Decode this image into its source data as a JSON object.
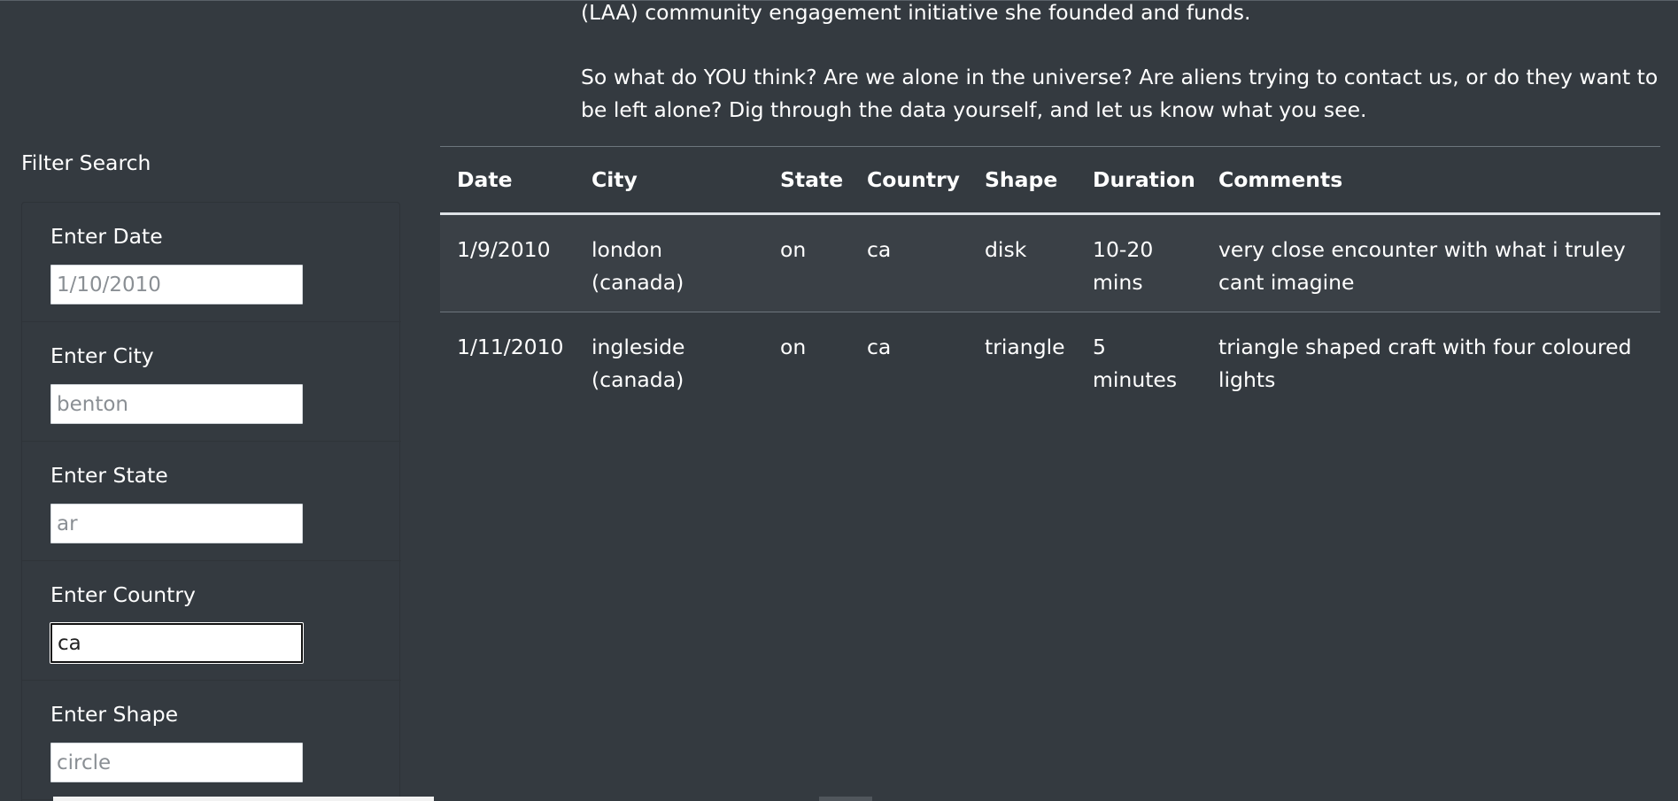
{
  "intro": {
    "line_top": "(LAA) community engagement initiative she founded and funds.",
    "paragraph": "So what do YOU think? Are we alone in the universe? Are aliens trying to contact us, or do they want to be left alone? Dig through the data yourself, and let us know what you see."
  },
  "filter": {
    "title": "Filter Search",
    "items": [
      {
        "label": "Enter Date",
        "placeholder": "1/10/2010",
        "value": ""
      },
      {
        "label": "Enter City",
        "placeholder": "benton",
        "value": ""
      },
      {
        "label": "Enter State",
        "placeholder": "ar",
        "value": ""
      },
      {
        "label": "Enter Country",
        "placeholder": "",
        "value": "ca"
      },
      {
        "label": "Enter Shape",
        "placeholder": "circle",
        "value": ""
      }
    ]
  },
  "table": {
    "headers": [
      "Date",
      "City",
      "State",
      "Country",
      "Shape",
      "Duration",
      "Comments"
    ],
    "rows": [
      [
        "1/9/2010",
        "london (canada)",
        "on",
        "ca",
        "disk",
        "10-20 mins",
        "very close encounter with what i truley cant imagine"
      ],
      [
        "1/11/2010",
        "ingleside (canada)",
        "on",
        "ca",
        "triangle",
        "5 minutes",
        "triangle shaped craft with four coloured lights"
      ]
    ]
  }
}
